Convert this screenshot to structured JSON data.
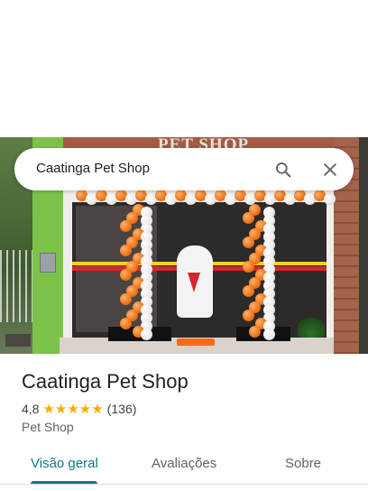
{
  "search": {
    "query": "Caatinga Pet Shop"
  },
  "photo": {
    "sign_text": "PET SHOP"
  },
  "place": {
    "title": "Caatinga Pet Shop",
    "rating": "4,8",
    "stars": "★★★★★",
    "reviews_count": "(136)",
    "category": "Pet Shop"
  },
  "tabs": [
    {
      "label": "Visão geral",
      "selected": true
    },
    {
      "label": "Avaliações",
      "selected": false
    },
    {
      "label": "Sobre",
      "selected": false
    }
  ],
  "colors": {
    "accent": "#0b7b86",
    "stars": "#f9ab00"
  },
  "icons": [
    "search-icon",
    "close-icon"
  ]
}
